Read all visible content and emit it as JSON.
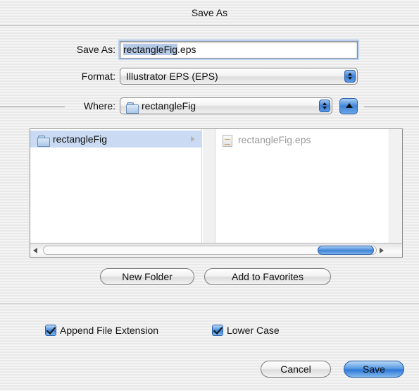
{
  "window": {
    "title": "Save As"
  },
  "form": {
    "save_as_label": "Save As:",
    "filename_selected": "rectangleFig",
    "filename_ext": ".eps",
    "format_label": "Format:",
    "format_value": "Illustrator EPS (EPS)",
    "where_label": "Where:",
    "where_value": "rectangleFig"
  },
  "browser": {
    "column1": [
      {
        "name": "rectangleFig",
        "kind": "folder",
        "selected": true
      }
    ],
    "column2": [
      {
        "name": "rectangleFig.eps",
        "kind": "file",
        "enabled": false
      }
    ]
  },
  "buttons": {
    "new_folder": "New Folder",
    "add_to_favorites": "Add to Favorites",
    "cancel": "Cancel",
    "save": "Save"
  },
  "options": {
    "append_extension": {
      "label": "Append File Extension",
      "checked": true
    },
    "lower_case": {
      "label": "Lower Case",
      "checked": true
    }
  },
  "colors": {
    "accent": "#3f84d8",
    "selection": "#c9daf2"
  }
}
